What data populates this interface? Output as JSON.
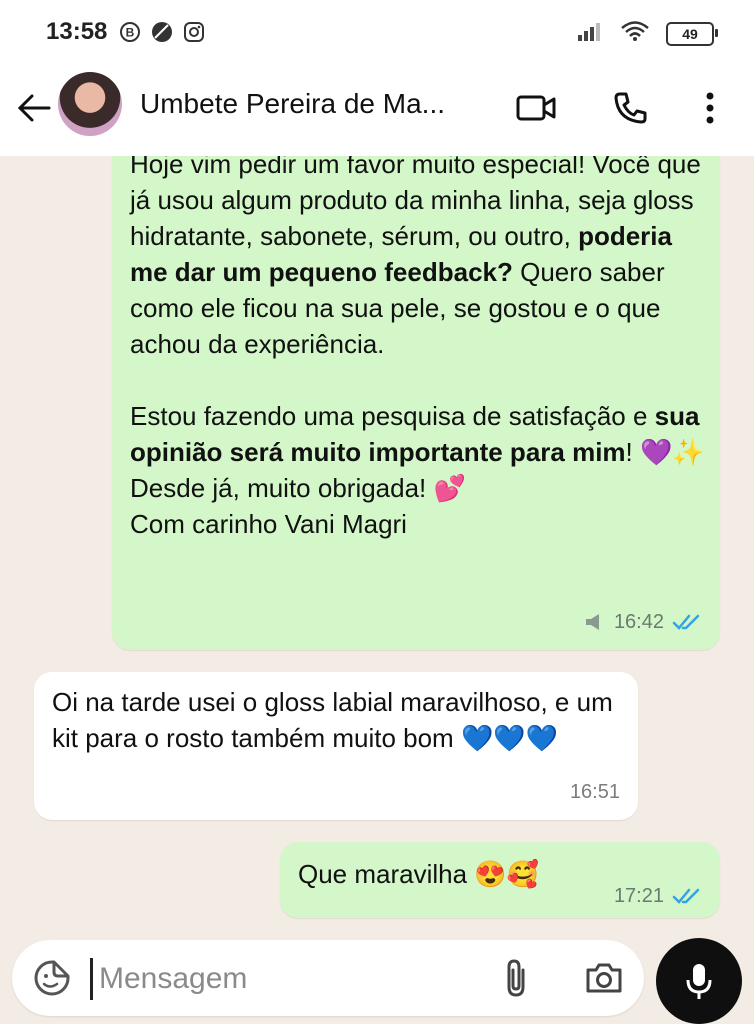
{
  "status_bar": {
    "time": "13:58",
    "battery": "49"
  },
  "header": {
    "contact_name": "Umbete Pereira de Ma..."
  },
  "messages": [
    {
      "direction": "outgoing",
      "lines_part1": "Hoje vim pedir um favor muito especial! Você que já usou algum produto da minha linha, seja gloss hidratante, sabonete, sérum, ou outro, ",
      "bold1": "poderia me dar um pequeno feedback?",
      "part2": " Quero saber como ele ficou na sua pele, se gostou e o que achou da experiência.",
      "para2_a": "Estou fazendo uma pesquisa de satisfação e ",
      "bold2": "sua opinião será muito importante para mim",
      "para2_b": "! 💜✨ Desde já, muito obrigada! 💕",
      "signature": "Com carinho Vani Magri",
      "time": "16:42"
    },
    {
      "direction": "incoming",
      "text": "Oi na tarde usei o gloss labial maravilhoso, e um kit para o rosto também muito bom 💙💙💙",
      "time": "16:51"
    },
    {
      "direction": "outgoing",
      "text": "Que maravilha 😍🥰",
      "time": "17:21"
    }
  ],
  "composer": {
    "placeholder": "Mensagem"
  },
  "colors": {
    "outgoing_bubble": "#d3f7c9",
    "incoming_bubble": "#ffffff",
    "read_ticks": "#34a3e0",
    "chat_background": "#f3ece4"
  },
  "icons": [
    "back-arrow-icon",
    "video-call-icon",
    "phone-icon",
    "more-vert-icon",
    "sticker-icon",
    "attach-icon",
    "camera-icon",
    "mic-icon",
    "double-check-icon",
    "broadcast-icon"
  ]
}
